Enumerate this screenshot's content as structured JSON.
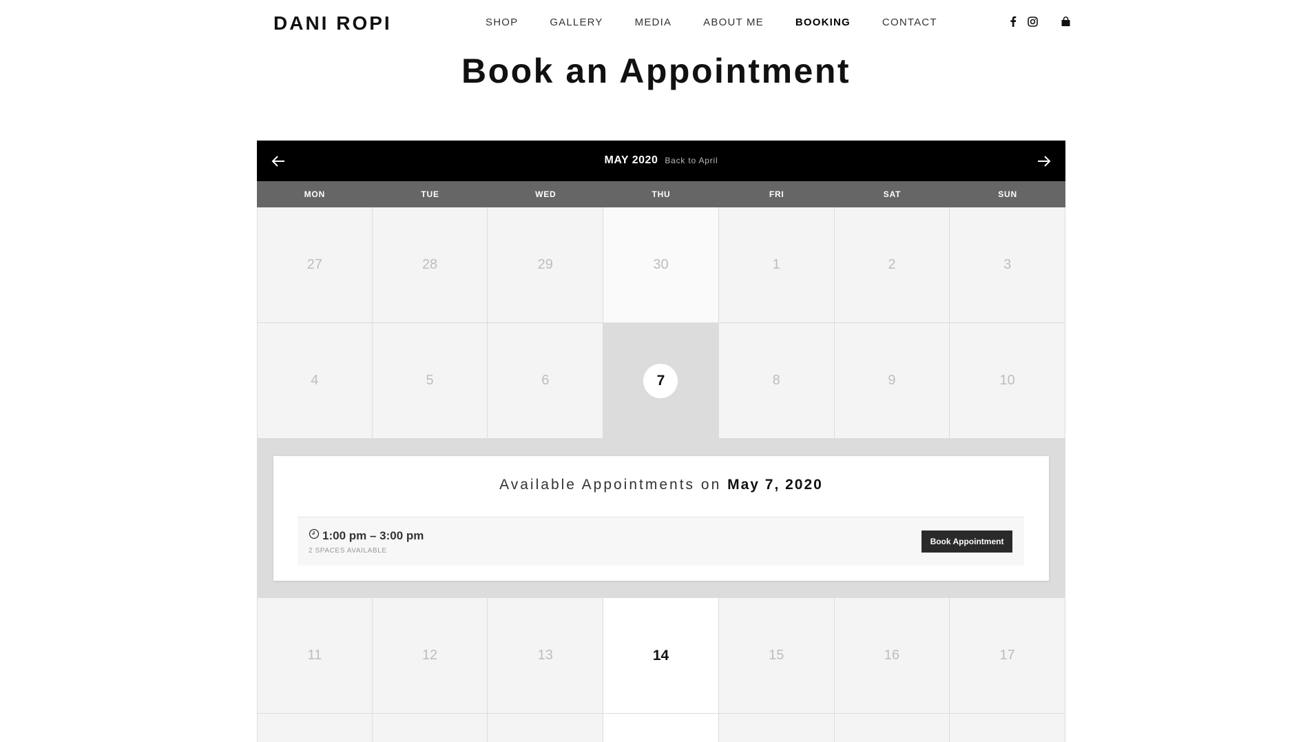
{
  "header": {
    "logo": "DANI ROPI",
    "nav": [
      "SHOP",
      "GALLERY",
      "MEDIA",
      "ABOUT ME",
      "BOOKING",
      "CONTACT"
    ],
    "active_nav": "BOOKING",
    "social_icons": [
      "facebook-icon",
      "instagram-icon",
      "shopping-bag-icon"
    ]
  },
  "page": {
    "title": "Book an Appointment"
  },
  "calendar": {
    "month_label": "MAY 2020",
    "back_label": "Back to April",
    "weekdays": [
      "MON",
      "TUE",
      "WED",
      "THU",
      "FRI",
      "SAT",
      "SUN"
    ],
    "week1": [
      "27",
      "28",
      "29",
      "30",
      "1",
      "2",
      "3"
    ],
    "week2": [
      "4",
      "5",
      "6",
      "7",
      "8",
      "9",
      "10"
    ],
    "week3": [
      "11",
      "12",
      "13",
      "14",
      "15",
      "16",
      "17"
    ],
    "selected_day": "7",
    "today": "14"
  },
  "appointments": {
    "heading_prefix": "Available Appointments on",
    "heading_date": "May 7, 2020",
    "slots": [
      {
        "time": "1:00 pm – 3:00 pm",
        "spaces": "2 SPACES AVAILABLE",
        "button": "Book Appointment"
      }
    ]
  },
  "colors": {
    "header_bg": "#000000",
    "weekday_bg": "#666666",
    "selected_bg": "#dcdcdc",
    "button_bg": "#2a2a2a"
  }
}
